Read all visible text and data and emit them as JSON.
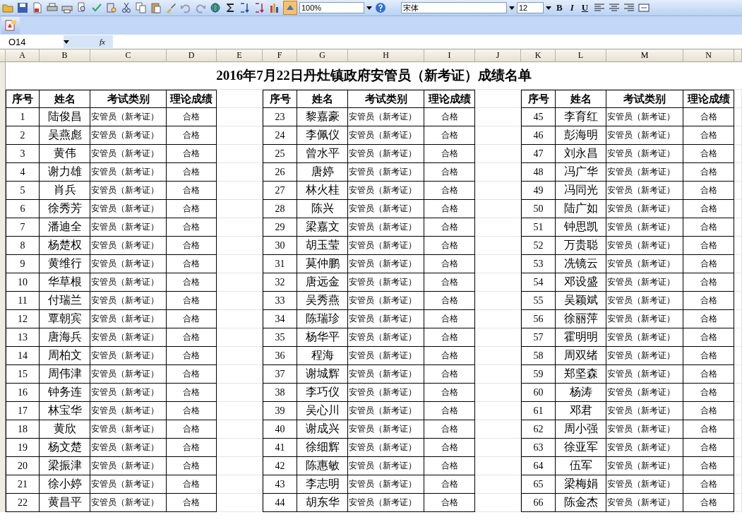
{
  "toolbar": {
    "zoom": "100%",
    "font": "宋体",
    "font_size": "12",
    "bold": "B",
    "italic": "I",
    "underline": "U"
  },
  "formula_bar": {
    "cell": "O14",
    "fx": "fx"
  },
  "column_letters": [
    "A",
    "B",
    "C",
    "D",
    "E",
    "F",
    "G",
    "H",
    "I",
    "J",
    "K",
    "L",
    "M",
    "N"
  ],
  "title": "2016年7月22日丹灶镇政府安管员（新考证）成绩名单",
  "blocks": [
    {
      "headers": [
        "序号",
        "姓名",
        "考试类别",
        "理论成绩"
      ],
      "rows": [
        {
          "no": "1",
          "name": "陆俊昌",
          "type": "安管员（新考证）",
          "result": "合格"
        },
        {
          "no": "2",
          "name": "吴燕彪",
          "type": "安管员（新考证）",
          "result": "合格"
        },
        {
          "no": "3",
          "name": "黄伟",
          "type": "安管员（新考证）",
          "result": "合格"
        },
        {
          "no": "4",
          "name": "谢力雄",
          "type": "安管员（新考证）",
          "result": "合格"
        },
        {
          "no": "5",
          "name": "肖兵",
          "type": "安管员（新考证）",
          "result": "合格"
        },
        {
          "no": "6",
          "name": "徐秀芳",
          "type": "安管员（新考证）",
          "result": "合格"
        },
        {
          "no": "7",
          "name": "潘迪全",
          "type": "安管员（新考证）",
          "result": "合格"
        },
        {
          "no": "8",
          "name": "杨楚权",
          "type": "安管员（新考证）",
          "result": "合格"
        },
        {
          "no": "9",
          "name": "黄维行",
          "type": "安管员（新考证）",
          "result": "合格"
        },
        {
          "no": "10",
          "name": "华草根",
          "type": "安管员（新考证）",
          "result": "合格"
        },
        {
          "no": "11",
          "name": "付瑞兰",
          "type": "安管员（新考证）",
          "result": "合格"
        },
        {
          "no": "12",
          "name": "覃朝宾",
          "type": "安管员（新考证）",
          "result": "合格"
        },
        {
          "no": "13",
          "name": "唐海兵",
          "type": "安管员（新考证）",
          "result": "合格"
        },
        {
          "no": "14",
          "name": "周柏文",
          "type": "安管员（新考证）",
          "result": "合格"
        },
        {
          "no": "15",
          "name": "周伟津",
          "type": "安管员（新考证）",
          "result": "合格"
        },
        {
          "no": "16",
          "name": "钟务连",
          "type": "安管员（新考证）",
          "result": "合格"
        },
        {
          "no": "17",
          "name": "林宝华",
          "type": "安管员（新考证）",
          "result": "合格"
        },
        {
          "no": "18",
          "name": "黄欣",
          "type": "安管员（新考证）",
          "result": "合格"
        },
        {
          "no": "19",
          "name": "杨文楚",
          "type": "安管员（新考证）",
          "result": "合格"
        },
        {
          "no": "20",
          "name": "梁振津",
          "type": "安管员（新考证）",
          "result": "合格"
        },
        {
          "no": "21",
          "name": "徐小婷",
          "type": "安管员（新考证）",
          "result": "合格"
        },
        {
          "no": "22",
          "name": "黄昌平",
          "type": "安管员（新考证）",
          "result": "合格"
        }
      ]
    },
    {
      "headers": [
        "序号",
        "姓名",
        "考试类别",
        "理论成绩"
      ],
      "rows": [
        {
          "no": "23",
          "name": "黎嘉豪",
          "type": "安管员（新考证）",
          "result": "合格"
        },
        {
          "no": "24",
          "name": "李佩仪",
          "type": "安管员（新考证）",
          "result": "合格"
        },
        {
          "no": "25",
          "name": "曾水平",
          "type": "安管员（新考证）",
          "result": "合格"
        },
        {
          "no": "26",
          "name": "唐婷",
          "type": "安管员（新考证）",
          "result": "合格"
        },
        {
          "no": "27",
          "name": "林火桂",
          "type": "安管员（新考证）",
          "result": "合格"
        },
        {
          "no": "28",
          "name": "陈兴",
          "type": "安管员（新考证）",
          "result": "合格"
        },
        {
          "no": "29",
          "name": "梁嘉文",
          "type": "安管员（新考证）",
          "result": "合格"
        },
        {
          "no": "30",
          "name": "胡玉莹",
          "type": "安管员（新考证）",
          "result": "合格"
        },
        {
          "no": "31",
          "name": "莫仲鹏",
          "type": "安管员（新考证）",
          "result": "合格"
        },
        {
          "no": "32",
          "name": "唐远金",
          "type": "安管员（新考证）",
          "result": "合格"
        },
        {
          "no": "33",
          "name": "吴秀燕",
          "type": "安管员（新考证）",
          "result": "合格"
        },
        {
          "no": "34",
          "name": "陈瑞珍",
          "type": "安管员（新考证）",
          "result": "合格"
        },
        {
          "no": "35",
          "name": "杨华平",
          "type": "安管员（新考证）",
          "result": "合格"
        },
        {
          "no": "36",
          "name": "程海",
          "type": "安管员（新考证）",
          "result": "合格"
        },
        {
          "no": "37",
          "name": "谢城辉",
          "type": "安管员（新考证）",
          "result": "合格"
        },
        {
          "no": "38",
          "name": "李巧仪",
          "type": "安管员（新考证）",
          "result": "合格"
        },
        {
          "no": "39",
          "name": "吴心川",
          "type": "安管员（新考证）",
          "result": "合格"
        },
        {
          "no": "40",
          "name": "谢成兴",
          "type": "安管员（新考证）",
          "result": "合格"
        },
        {
          "no": "41",
          "name": "徐细辉",
          "type": "安管员（新考证）",
          "result": "合格"
        },
        {
          "no": "42",
          "name": "陈惠敏",
          "type": "安管员（新考证）",
          "result": "合格"
        },
        {
          "no": "43",
          "name": "李志明",
          "type": "安管员（新考证）",
          "result": "合格"
        },
        {
          "no": "44",
          "name": "胡东华",
          "type": "安管员（新考证）",
          "result": "合格"
        }
      ]
    },
    {
      "headers": [
        "序号",
        "姓名",
        "考试类别",
        "理论成绩"
      ],
      "rows": [
        {
          "no": "45",
          "name": "李育红",
          "type": "安管员（新考证）",
          "result": "合格"
        },
        {
          "no": "46",
          "name": "彭海明",
          "type": "安管员（新考证）",
          "result": "合格"
        },
        {
          "no": "47",
          "name": "刘永昌",
          "type": "安管员（新考证）",
          "result": "合格"
        },
        {
          "no": "48",
          "name": "冯广华",
          "type": "安管员（新考证）",
          "result": "合格"
        },
        {
          "no": "49",
          "name": "冯同光",
          "type": "安管员（新考证）",
          "result": "合格"
        },
        {
          "no": "50",
          "name": "陆广如",
          "type": "安管员（新考证）",
          "result": "合格"
        },
        {
          "no": "51",
          "name": "钟思凯",
          "type": "安管员（新考证）",
          "result": "合格"
        },
        {
          "no": "52",
          "name": "万贵聪",
          "type": "安管员（新考证）",
          "result": "合格"
        },
        {
          "no": "53",
          "name": "冼镜云",
          "type": "安管员（新考证）",
          "result": "合格"
        },
        {
          "no": "54",
          "name": "邓设盛",
          "type": "安管员（新考证）",
          "result": "合格"
        },
        {
          "no": "55",
          "name": "吴颖斌",
          "type": "安管员（新考证）",
          "result": "合格"
        },
        {
          "no": "56",
          "name": "徐丽萍",
          "type": "安管员（新考证）",
          "result": "合格"
        },
        {
          "no": "57",
          "name": "霍明明",
          "type": "安管员（新考证）",
          "result": "合格"
        },
        {
          "no": "58",
          "name": "周双绪",
          "type": "安管员（新考证）",
          "result": "合格"
        },
        {
          "no": "59",
          "name": "郑坚森",
          "type": "安管员（新考证）",
          "result": "合格"
        },
        {
          "no": "60",
          "name": "杨涛",
          "type": "安管员（新考证）",
          "result": "合格"
        },
        {
          "no": "61",
          "name": "邓君",
          "type": "安管员（新考证）",
          "result": "合格"
        },
        {
          "no": "62",
          "name": "周小强",
          "type": "安管员（新考证）",
          "result": "合格"
        },
        {
          "no": "63",
          "name": "徐亚军",
          "type": "安管员（新考证）",
          "result": "合格"
        },
        {
          "no": "64",
          "name": "伍军",
          "type": "安管员（新考证）",
          "result": "合格"
        },
        {
          "no": "65",
          "name": "梁梅娟",
          "type": "安管员（新考证）",
          "result": "合格"
        },
        {
          "no": "66",
          "name": "陈金杰",
          "type": "安管员（新考证）",
          "result": "合格"
        }
      ]
    }
  ]
}
